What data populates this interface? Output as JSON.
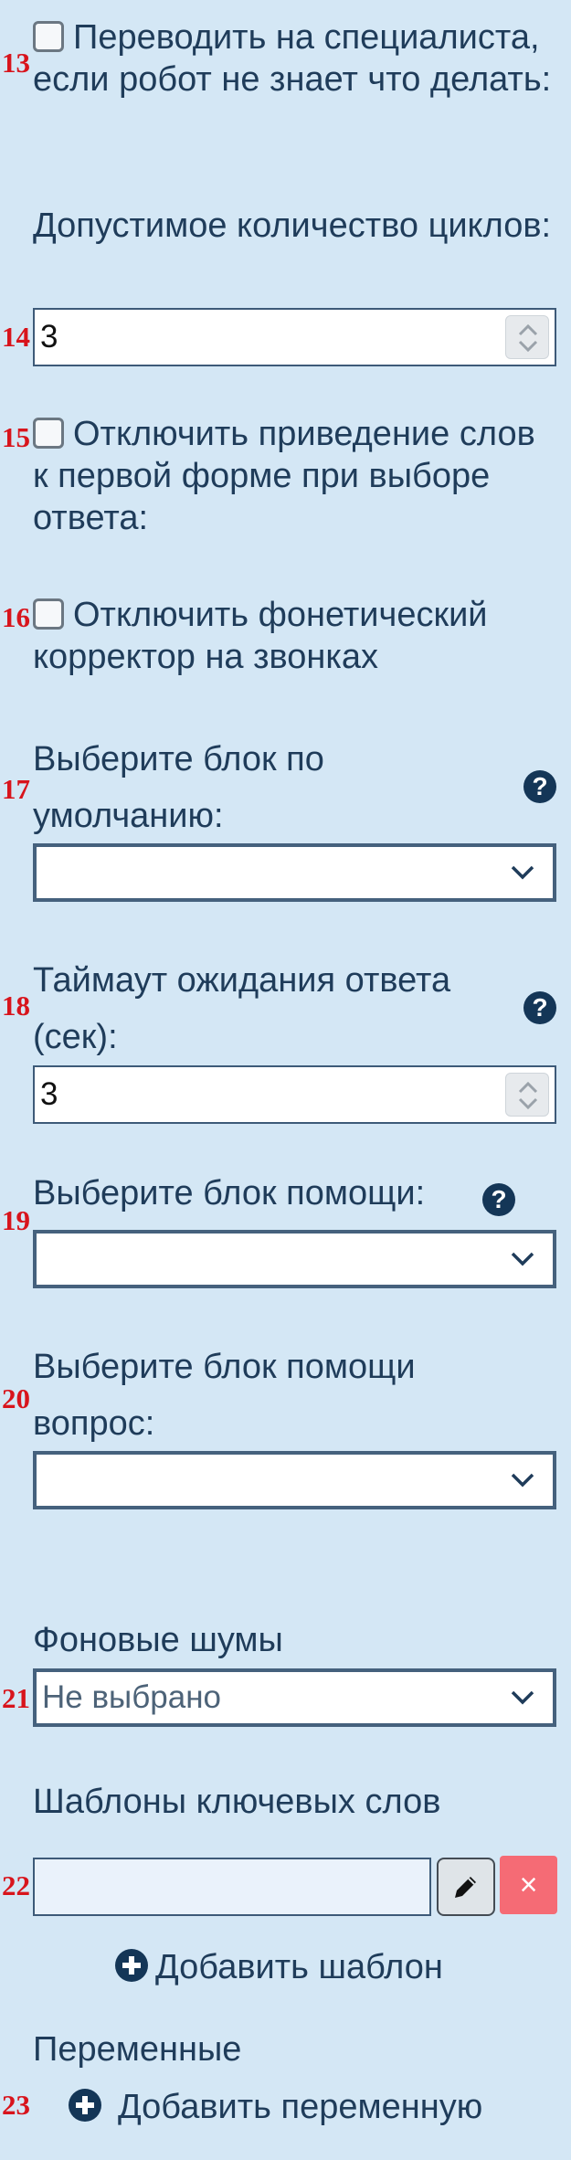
{
  "markers": [
    "13",
    "14",
    "15",
    "16",
    "17",
    "18",
    "19",
    "20",
    "21",
    "22",
    "23"
  ],
  "settings": {
    "transfer_to_specialist": {
      "label": "Переводить на специалиста, если робот не знает что делать:",
      "checked": false
    },
    "cycles": {
      "label": "Допустимое количество циклов:",
      "value": "3"
    },
    "disable_lemmatization": {
      "label": "Отключить приведение слов к первой форме при выборе ответа:",
      "checked": false
    },
    "disable_phonetic": {
      "label": "Отключить фонетический корректор на звонках",
      "checked": false
    },
    "default_block": {
      "label": "Выберите блок по умолчанию:",
      "value": ""
    },
    "timeout": {
      "label": "Таймаут ожидания ответа (сек):",
      "value": "3"
    },
    "help_block": {
      "label": "Выберите блок помощи:",
      "value": ""
    },
    "help_question_block": {
      "label": "Выберите блок помощи вопрос:",
      "value": ""
    },
    "background_noise": {
      "label": "Фоновые шумы",
      "value": "Не выбрано"
    },
    "keyword_templates": {
      "label": "Шаблоны ключевых слов",
      "value": "",
      "delete_label": "×",
      "add_label": "Добавить шаблон"
    },
    "variables": {
      "label": "Переменные",
      "add_label": "Добавить переменную"
    }
  },
  "icons": {
    "help": "question-circle-icon",
    "plus": "plus-circle-icon",
    "edit": "pencil-icon",
    "dropdown": "chevron-down-icon",
    "spinner": "up-down-chevron-icon",
    "delete": "x-icon"
  },
  "colors": {
    "background": "#d4e7f5",
    "text": "#1f3c5a",
    "marker": "#d8141c",
    "delete_button": "#f56b75"
  }
}
